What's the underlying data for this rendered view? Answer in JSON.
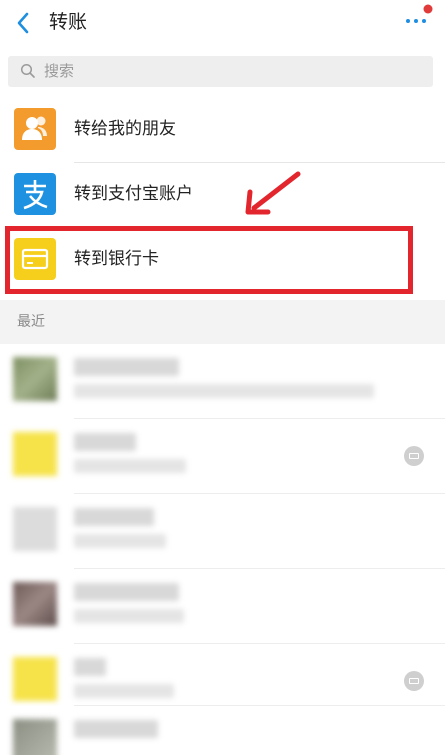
{
  "header": {
    "title": "转账",
    "back_icon": "chevron-left-icon",
    "more_icon": "more-dots-icon",
    "accent_color": "#1e8ee0",
    "notification_dot_color": "#e03a3a"
  },
  "search": {
    "placeholder": "搜索",
    "icon": "search-icon"
  },
  "options": [
    {
      "label": "转给我的朋友",
      "icon": "friends-icon",
      "color": "#f39b2c"
    },
    {
      "label": "转到支付宝账户",
      "icon": "alipay-icon",
      "color": "#1e92e0"
    },
    {
      "label": "转到银行卡",
      "icon": "bank-card-icon",
      "color": "#f6cf1d",
      "highlighted": true
    }
  ],
  "annotation": {
    "highlight_color": "#e3262d",
    "arrow": "red-arrow"
  },
  "recent": {
    "title": "最近",
    "contacts_note": "names blurred"
  }
}
